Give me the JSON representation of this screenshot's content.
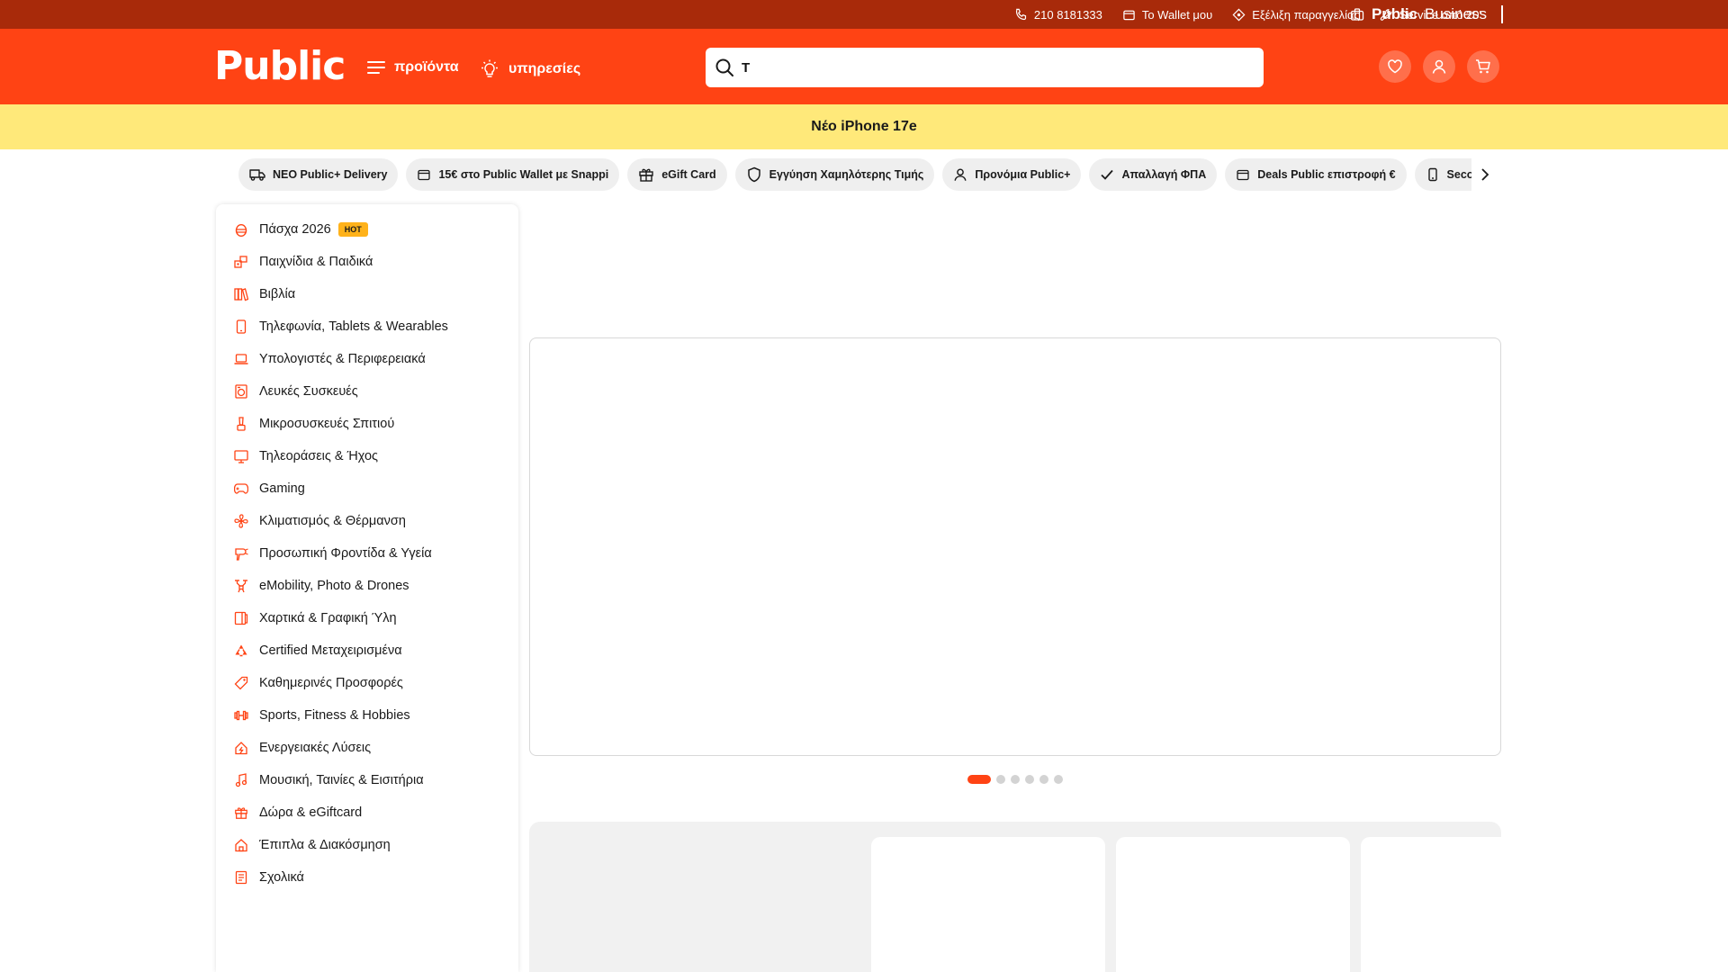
{
  "topbar": {
    "phone": "210 8181333",
    "wallet": "Το Wallet μου",
    "order_tracking": "Εξέλιξη παραγγελίας",
    "service": "Service από 20'",
    "business_bold": "Public",
    "business_rest": "Business"
  },
  "header": {
    "logo": "Public",
    "products_label": "προϊόντα",
    "services_label": "υπηρεσίες",
    "search_value": "T"
  },
  "promo": {
    "text": "Νέο iPhone 17e"
  },
  "chips": [
    {
      "label": "ΝΕΟ Public+ Delivery",
      "icon": "truck-icon"
    },
    {
      "label": "15€ στο Public Wallet με Snappi",
      "icon": "wallet-icon"
    },
    {
      "label": "eGift Card",
      "icon": "gift-icon"
    },
    {
      "label": "Εγγύηση Χαμηλότερης Τιμής",
      "icon": "shield-icon"
    },
    {
      "label": "Προνόμια Public+",
      "icon": "user-icon"
    },
    {
      "label": "Απαλλαγή ΦΠΑ",
      "icon": "check-icon"
    },
    {
      "label": "Deals Public επιστροφή €",
      "icon": "wallet-icon"
    },
    {
      "label": "Second Hand",
      "icon": "phone-icon"
    }
  ],
  "categories": [
    {
      "label": "Πάσχα 2026",
      "icon": "egg-icon",
      "badge": "HOT"
    },
    {
      "label": "Παιχνίδια & Παιδικά",
      "icon": "toys-icon"
    },
    {
      "label": "Βιβλία",
      "icon": "books-icon"
    },
    {
      "label": "Τηλεφωνία, Tablets & Wearables",
      "icon": "phone-icon"
    },
    {
      "label": "Υπολογιστές & Περιφερειακά",
      "icon": "laptop-icon"
    },
    {
      "label": "Λευκές Συσκευές",
      "icon": "washer-icon"
    },
    {
      "label": "Μικροσυσκευές Σπιτιού",
      "icon": "blender-icon"
    },
    {
      "label": "Τηλεοράσεις & Ήχος",
      "icon": "tv-icon"
    },
    {
      "label": "Gaming",
      "icon": "gamepad-icon"
    },
    {
      "label": "Κλιματισμός & Θέρμανση",
      "icon": "fan-icon"
    },
    {
      "label": "Προσωπική Φροντίδα & Υγεία",
      "icon": "hairdryer-icon"
    },
    {
      "label": "eMobility, Photo & Drones",
      "icon": "drone-icon"
    },
    {
      "label": "Χαρτικά & Γραφική Ύλη",
      "icon": "notebook-icon"
    },
    {
      "label": "Certified Μεταχειρισμένα",
      "icon": "recycle-icon"
    },
    {
      "label": "Καθημερινές Προσφορές",
      "icon": "tag-icon"
    },
    {
      "label": "Sports, Fitness & Hobbies",
      "icon": "dumbbell-icon"
    },
    {
      "label": "Ενεργειακές Λύσεις",
      "icon": "energy-icon"
    },
    {
      "label": "Μουσική, Ταινίες & Εισιτήρια",
      "icon": "music-icon"
    },
    {
      "label": "Δώρα & eGiftcard",
      "icon": "gift-icon"
    },
    {
      "label": "Έπιπλα & Διακόσμηση",
      "icon": "home-icon"
    },
    {
      "label": "Σχολικά",
      "icon": "school-icon"
    }
  ],
  "carousel": {
    "total_slides": 6,
    "active_slide": 1
  },
  "colors": {
    "brand_orange": "#ff4314",
    "topbar_dark": "#a82a0a",
    "promo_yellow": "#ffe97a",
    "badge_yellow": "#ffb21a"
  }
}
